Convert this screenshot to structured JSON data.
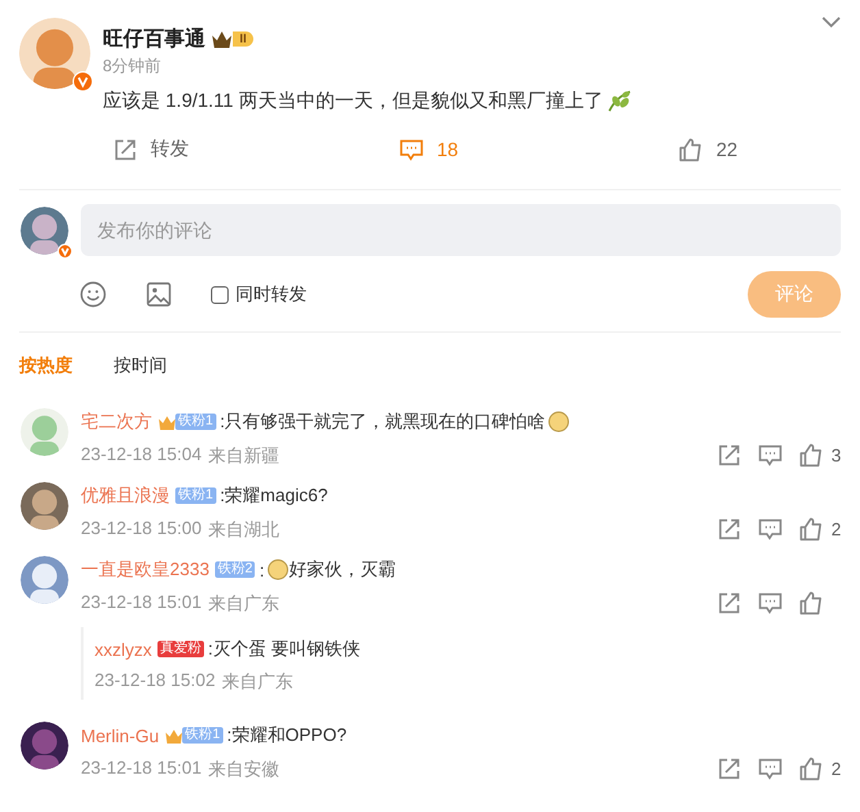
{
  "post": {
    "author": "旺仔百事通",
    "author_badge": "II",
    "verified": true,
    "time": "8分钟前",
    "body": [
      {
        "kind": "text",
        "text": "应该是 1.9/1.11 两天当中的一天，但是貌似又和黑厂撞上了"
      },
      {
        "kind": "leaf"
      }
    ],
    "actions": [
      {
        "kind": "repost",
        "label": "转发",
        "selected": false
      },
      {
        "kind": "comment",
        "label": "18",
        "selected": true
      },
      {
        "kind": "like",
        "label": "22",
        "selected": false
      }
    ]
  },
  "composer": {
    "verified": true,
    "placeholder": "发布你的评论",
    "also_repost": {
      "label": "同时转发",
      "checked": false
    },
    "submit": {
      "label": "评论",
      "disabled": true
    }
  },
  "sort_tabs": [
    {
      "label": "按热度",
      "selected": true
    },
    {
      "label": "按时间",
      "selected": false
    }
  ],
  "comments": [
    {
      "name": "宅二次方",
      "badge": {
        "kind": "crown",
        "label": "铁粉1"
      },
      "content": [
        {
          "kind": "text",
          "text": ":只有够强干就完了，就黑现在的口碑怕啥"
        },
        {
          "kind": "emoji"
        }
      ],
      "time": "23-12-18 15:04",
      "location": "来自新疆",
      "likes": "3"
    },
    {
      "name": "优雅且浪漫",
      "badge": {
        "kind": "fan",
        "label": "铁粉1"
      },
      "content": [
        {
          "kind": "text",
          "text": ":荣耀magic6?"
        }
      ],
      "time": "23-12-18 15:00",
      "location": "来自湖北",
      "likes": "2"
    },
    {
      "name": "一直是欧皇2333",
      "badge": {
        "kind": "fan",
        "label": "铁粉2"
      },
      "content": [
        {
          "kind": "text",
          "text": ":"
        },
        {
          "kind": "emoji"
        },
        {
          "kind": "text",
          "text": "好家伙，灭霸"
        }
      ],
      "time": "23-12-18 15:01",
      "location": "来自广东",
      "replies": [
        {
          "name": "xxzlyzx",
          "badge": {
            "kind": "super",
            "label": "真爱粉"
          },
          "content": [
            {
              "kind": "text",
              "text": ":灭个蛋 要叫钢铁侠"
            }
          ],
          "time": "23-12-18 15:02",
          "location": "来自广东"
        }
      ]
    },
    {
      "name": "Merlin-Gu",
      "badge": {
        "kind": "crown",
        "label": "铁粉1"
      },
      "content": [
        {
          "kind": "text",
          "text": ":荣耀和OPPO?"
        }
      ],
      "time": "23-12-18 15:01",
      "location": "来自安徽",
      "likes": "2"
    }
  ]
}
